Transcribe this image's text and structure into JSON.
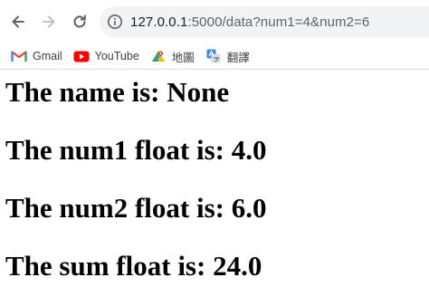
{
  "browser": {
    "url_host": "127.0.0.1",
    "url_rest": ":5000/data?num1=4&num2=6"
  },
  "bookmarks": [
    {
      "label": "Gmail",
      "icon": "gmail-icon"
    },
    {
      "label": "YouTube",
      "icon": "youtube-icon"
    },
    {
      "label": "地圖",
      "icon": "maps-icon"
    },
    {
      "label": "翻譯",
      "icon": "translate-icon"
    }
  ],
  "page": {
    "lines": [
      "The name is: None",
      "The num1 float is: 4.0",
      "The num2 float is: 6.0",
      "The sum float is: 24.0"
    ]
  },
  "colors": {
    "gmail": "#EA4335",
    "youtube": "#FF0000",
    "maps_green": "#34A853",
    "translate_blue": "#4285F4"
  }
}
